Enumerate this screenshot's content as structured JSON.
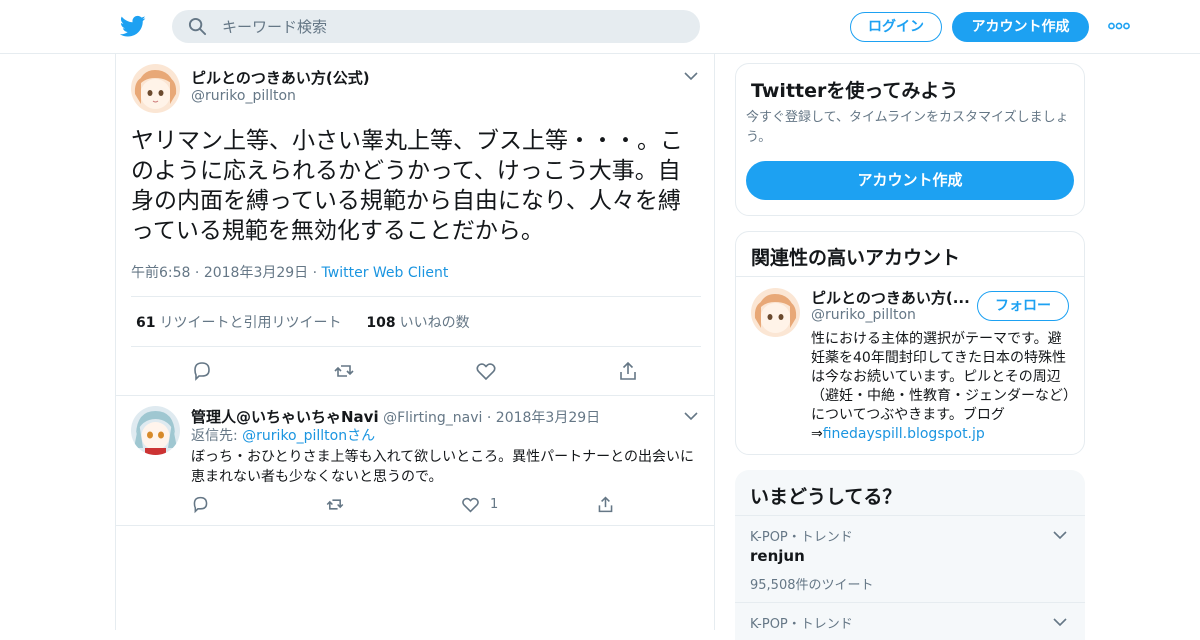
{
  "colors": {
    "accent": "#1da1f2",
    "link": "#1b95e0",
    "text": "#14171a",
    "muted": "#657786",
    "border": "#e6ecf0"
  },
  "header": {
    "logo_icon": "twitter-bird-icon",
    "search_placeholder": "キーワード検索",
    "login_label": "ログイン",
    "signup_label": "アカウント作成",
    "more_icon": "more-dots-icon"
  },
  "tweet": {
    "display_name": "ピルとのつきあい方(公式)",
    "handle": "@ruriko_pillton",
    "text": "ヤリマン上等、小さい睾丸上等、ブス上等・・・。このように応えられるかどうかって、けっこう大事。自身の内面を縛っている規範から自由になり、人々を縛っている規範を無効化することだから。",
    "time": "午前6:58",
    "date": "2018年3月29日",
    "client": "Twitter Web Client",
    "retweet_count": "61",
    "retweet_label": "リツイートと引用リツイート",
    "like_count": "108",
    "like_label": "いいねの数"
  },
  "reply": {
    "display_name": "管理人@いちゃいちゃNavi",
    "handle": "@Flirting_navi",
    "date": "2018年3月29日",
    "reply_to_prefix": "返信先: ",
    "reply_to_handle": "@ruriko_pilltonさん",
    "text": "ぼっち・おひとりさま上等も入れて欲しいところ。異性パートナーとの出会いに恵まれない者も少なくないと思うので。",
    "like_count": "1"
  },
  "signup_card": {
    "title": "Twitterを使ってみよう",
    "desc": "今すぐ登録して、タイムラインをカスタマイズしましょう。",
    "button": "アカウント作成"
  },
  "related_card": {
    "title": "関連性の高いアカウント",
    "name": "ピルとのつきあい方(...",
    "handle": "@ruriko_pillton",
    "follow": "フォロー",
    "bio": "性における主体的選択がテーマです。避妊薬を40年間封印してきた日本の特殊性は今なお続いています。ピルとその周辺（避妊・中絶・性教育・ジェンダーなど）についてつぶやきます。ブログ⇒",
    "bio_link": "finedayspill.blogspot.jp"
  },
  "trends": {
    "title": "いまどうしてる？",
    "items": [
      {
        "context": "K-POP・トレンド",
        "name": "renjun",
        "count": "95,508件のツイート"
      },
      {
        "context": "K-POP・トレンド"
      }
    ]
  }
}
